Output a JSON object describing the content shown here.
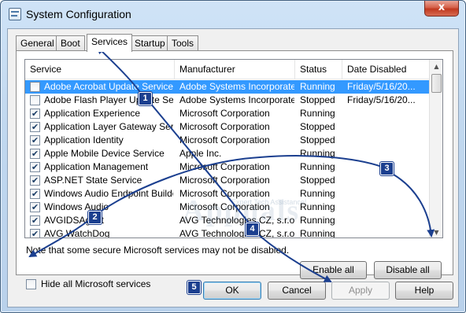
{
  "window": {
    "title": "System Configuration",
    "close_glyph": "x"
  },
  "tabs": [
    {
      "label": "General",
      "active": false
    },
    {
      "label": "Boot",
      "active": false
    },
    {
      "label": "Services",
      "active": true
    },
    {
      "label": "Startup",
      "active": false
    },
    {
      "label": "Tools",
      "active": false
    }
  ],
  "columns": [
    "Service",
    "Manufacturer",
    "Status",
    "Date Disabled"
  ],
  "services": [
    {
      "checked": false,
      "name": "Adobe Acrobat Update Service",
      "manufacturer": "Adobe Systems Incorporated",
      "status": "Running",
      "date_disabled": "Friday/5/16/20...",
      "selected": true
    },
    {
      "checked": false,
      "name": "Adobe Flash Player Update Service",
      "manufacturer": "Adobe Systems Incorporated",
      "status": "Stopped",
      "date_disabled": "Friday/5/16/20...",
      "selected": false
    },
    {
      "checked": true,
      "name": "Application Experience",
      "manufacturer": "Microsoft Corporation",
      "status": "Running",
      "date_disabled": "",
      "selected": false
    },
    {
      "checked": true,
      "name": "Application Layer Gateway Service",
      "manufacturer": "Microsoft Corporation",
      "status": "Stopped",
      "date_disabled": "",
      "selected": false
    },
    {
      "checked": true,
      "name": "Application Identity",
      "manufacturer": "Microsoft Corporation",
      "status": "Stopped",
      "date_disabled": "",
      "selected": false
    },
    {
      "checked": true,
      "name": "Apple Mobile Device Service",
      "manufacturer": "Apple Inc.",
      "status": "Running",
      "date_disabled": "",
      "selected": false
    },
    {
      "checked": true,
      "name": "Application Management",
      "manufacturer": "Microsoft Corporation",
      "status": "Running",
      "date_disabled": "",
      "selected": false
    },
    {
      "checked": true,
      "name": "ASP.NET State Service",
      "manufacturer": "Microsoft Corporation",
      "status": "Stopped",
      "date_disabled": "",
      "selected": false
    },
    {
      "checked": true,
      "name": "Windows Audio Endpoint Builder",
      "manufacturer": "Microsoft Corporation",
      "status": "Running",
      "date_disabled": "",
      "selected": false
    },
    {
      "checked": true,
      "name": "Windows Audio",
      "manufacturer": "Microsoft Corporation",
      "status": "Running",
      "date_disabled": "",
      "selected": false
    },
    {
      "checked": true,
      "name": "AVGIDSAgent",
      "manufacturer": "AVG Technologies CZ, s.r.o.",
      "status": "Running",
      "date_disabled": "",
      "selected": false
    },
    {
      "checked": true,
      "name": "AVG WatchDog",
      "manufacturer": "AVG Technologies CZ, s.r.o.",
      "status": "Running",
      "date_disabled": "",
      "selected": false
    }
  ],
  "note": "Note that some secure Microsoft services may not be disabled.",
  "buttons": {
    "enable_all": "Enable all",
    "disable_all": "Disable all",
    "ok": "OK",
    "cancel": "Cancel",
    "apply": "Apply",
    "help": "Help"
  },
  "hide_ms_label": "Hide all Microsoft services",
  "watermark": {
    "main": "Appuals",
    "sub": "Expert Tech Assistance!"
  },
  "callouts": [
    "1",
    "2",
    "3",
    "4",
    "5"
  ],
  "colors": {
    "selection": "#3399ff",
    "callout": "#1b3f8f",
    "arrow": "#1b3f8f"
  }
}
